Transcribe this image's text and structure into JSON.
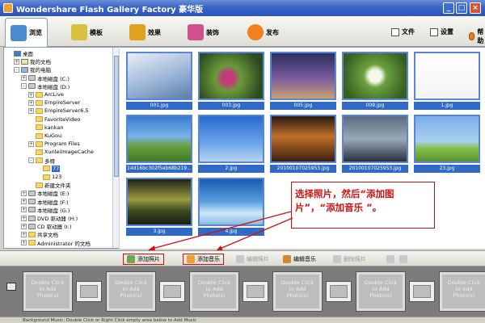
{
  "window": {
    "title": "Wondershare Flash Gallery Factory 豪华版",
    "minimize": "_",
    "maximize": "□",
    "close": "×"
  },
  "tabs": [
    {
      "label": "浏览",
      "color": "#4a8ad0",
      "active": true
    },
    {
      "label": "模板",
      "color": "#d8c040"
    },
    {
      "label": "效果",
      "color": "#e0a020"
    },
    {
      "label": "装饰",
      "color": "#d05090"
    },
    {
      "label": "发布",
      "color": "#f08020"
    }
  ],
  "menu": {
    "file": "文件",
    "settings": "设置",
    "help": "帮助"
  },
  "tree": [
    {
      "label": "桌面",
      "indent": 0,
      "icon": "desktop",
      "exp": ""
    },
    {
      "label": "我的文档",
      "indent": 1,
      "icon": "docs",
      "exp": "+"
    },
    {
      "label": "我的电脑",
      "indent": 1,
      "icon": "mycomp",
      "exp": "-"
    },
    {
      "label": "本地磁盘 (C:)",
      "indent": 2,
      "icon": "drive",
      "exp": "+"
    },
    {
      "label": "本地磁盘 (D:)",
      "indent": 2,
      "icon": "drive",
      "exp": "-"
    },
    {
      "label": "ArcLive",
      "indent": 3,
      "icon": "folder",
      "exp": "+"
    },
    {
      "label": "EmpireServer",
      "indent": 3,
      "icon": "folder",
      "exp": "+"
    },
    {
      "label": "EmpireServer6.5",
      "indent": 3,
      "icon": "folder",
      "exp": "+"
    },
    {
      "label": "FavoriteVideo",
      "indent": 3,
      "icon": "folder",
      "exp": ""
    },
    {
      "label": "kankan",
      "indent": 3,
      "icon": "folder",
      "exp": ""
    },
    {
      "label": "KuGou",
      "indent": 3,
      "icon": "folder",
      "exp": ""
    },
    {
      "label": "Program Files",
      "indent": 3,
      "icon": "folder",
      "exp": "+"
    },
    {
      "label": "XunleiImageCache",
      "indent": 3,
      "icon": "folder",
      "exp": ""
    },
    {
      "label": "多特",
      "indent": 3,
      "icon": "folder",
      "exp": "-"
    },
    {
      "label": "77",
      "indent": 4,
      "icon": "folder",
      "exp": "",
      "selected": true
    },
    {
      "label": "123",
      "indent": 4,
      "icon": "folder",
      "exp": ""
    },
    {
      "label": "新建文件夹",
      "indent": 3,
      "icon": "folder",
      "exp": ""
    },
    {
      "label": "本地磁盘 (E:)",
      "indent": 2,
      "icon": "drive",
      "exp": "+"
    },
    {
      "label": "本地磁盘 (F:)",
      "indent": 2,
      "icon": "drive",
      "exp": "+"
    },
    {
      "label": "本地磁盘 (G:)",
      "indent": 2,
      "icon": "drive",
      "exp": "+"
    },
    {
      "label": "DVD 驱动器 (H:)",
      "indent": 2,
      "icon": "drive",
      "exp": "+"
    },
    {
      "label": "CD 驱动器 (I:)",
      "indent": 2,
      "icon": "drive",
      "exp": "+"
    },
    {
      "label": "共享文档",
      "indent": 2,
      "icon": "folder",
      "exp": "+"
    },
    {
      "label": "Administrator 的文档",
      "indent": 2,
      "icon": "folder",
      "exp": "+"
    }
  ],
  "photos": [
    {
      "name": "001.jpg",
      "scene": "dragonfly"
    },
    {
      "name": "003.jpg",
      "scene": "flowers"
    },
    {
      "name": "005.jpg",
      "scene": "storm"
    },
    {
      "name": "009.jpg",
      "scene": "daisy"
    },
    {
      "name": "1.jpg",
      "scene": "plain"
    },
    {
      "name": "14d16bc302f5eb68b219...",
      "scene": "ocean"
    },
    {
      "name": "2.jpg",
      "scene": "sky"
    },
    {
      "name": "20100107025953.jpg",
      "scene": "sunset"
    },
    {
      "name": "20100107025953.jpg",
      "scene": "dusk"
    },
    {
      "name": "23.jpg",
      "scene": "tree"
    },
    {
      "name": "3.jpg",
      "scene": "evening"
    },
    {
      "name": "4.jpg",
      "scene": "ice"
    }
  ],
  "callout": {
    "line1": "选择照片，然后“添加图",
    "line2": "片”，“添加音乐 ”。"
  },
  "actions": {
    "add_photo": "添加照片",
    "add_music": "添加音乐",
    "edit_photo": "编辑照片",
    "edit_music": "编辑音乐",
    "delete_photo": "删除照片"
  },
  "storyboard": {
    "placeholder_l1": "Double Click",
    "placeholder_l2": "to Add",
    "placeholder_l3": "Photo(s)"
  },
  "status": "Background Music: Double Click or Right Click empty area below to Add Music"
}
